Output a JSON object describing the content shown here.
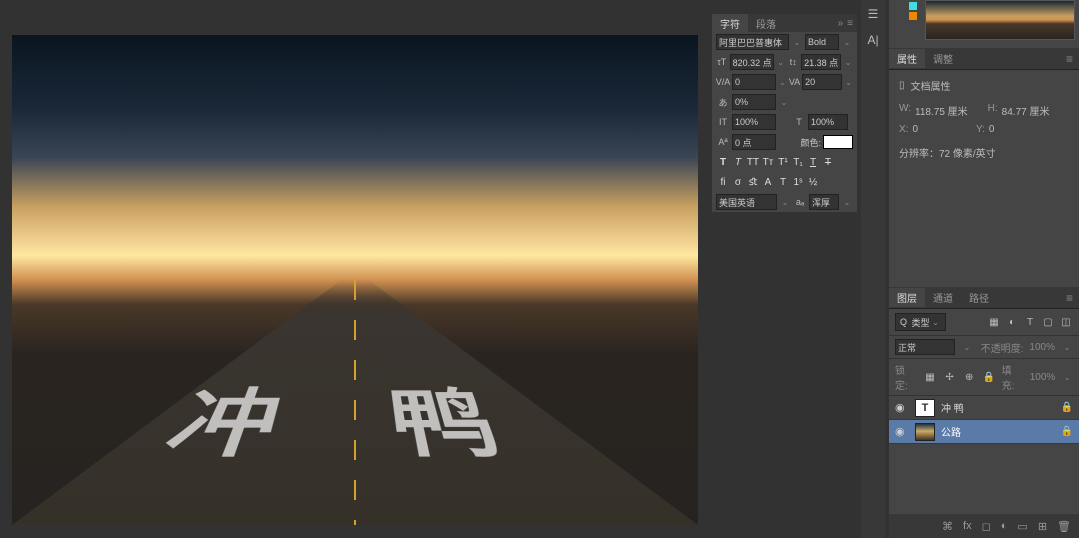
{
  "canvas": {
    "text_on_road": "冲 鸭"
  },
  "char_panel": {
    "tab_character": "字符",
    "tab_paragraph": "段落",
    "font_family": "阿里巴巴普惠体",
    "font_style": "Bold",
    "font_size": "820.32 点",
    "leading": "21.38 点",
    "va_tracking": "0",
    "kerning": "20",
    "scale_pct": "0%",
    "vert_scale": "100%",
    "horiz_scale": "100%",
    "baseline_shift": "0 点",
    "color_label": "颜色:",
    "lang": "美国英语",
    "aa": "浑厚"
  },
  "right_icons": {
    "adjust": "☰",
    "char": "A|"
  },
  "props": {
    "tab_props": "属性",
    "tab_adjust": "调整",
    "doc_title": "文档属性",
    "w_label": "W:",
    "w_val": "118.75 厘米",
    "h_label": "H:",
    "h_val": "84.77 厘米",
    "x_label": "X:",
    "x_val": "0",
    "y_label": "Y:",
    "y_val": "0",
    "res": "分辨率：72 像素/英寸"
  },
  "layers": {
    "tab_layers": "图层",
    "tab_channels": "通道",
    "tab_paths": "路径",
    "filter_label": "类型",
    "blend_mode": "正常",
    "opacity_label": "不透明度:",
    "opacity_val": "100%",
    "lock_label": "锁定:",
    "fill_label": "填充:",
    "fill_val": "100%",
    "items": [
      {
        "name": "冲 鸭",
        "type": "text",
        "visible": true,
        "active": false,
        "locked": true
      },
      {
        "name": "公路",
        "type": "image",
        "visible": true,
        "active": true,
        "locked": true
      }
    ]
  }
}
